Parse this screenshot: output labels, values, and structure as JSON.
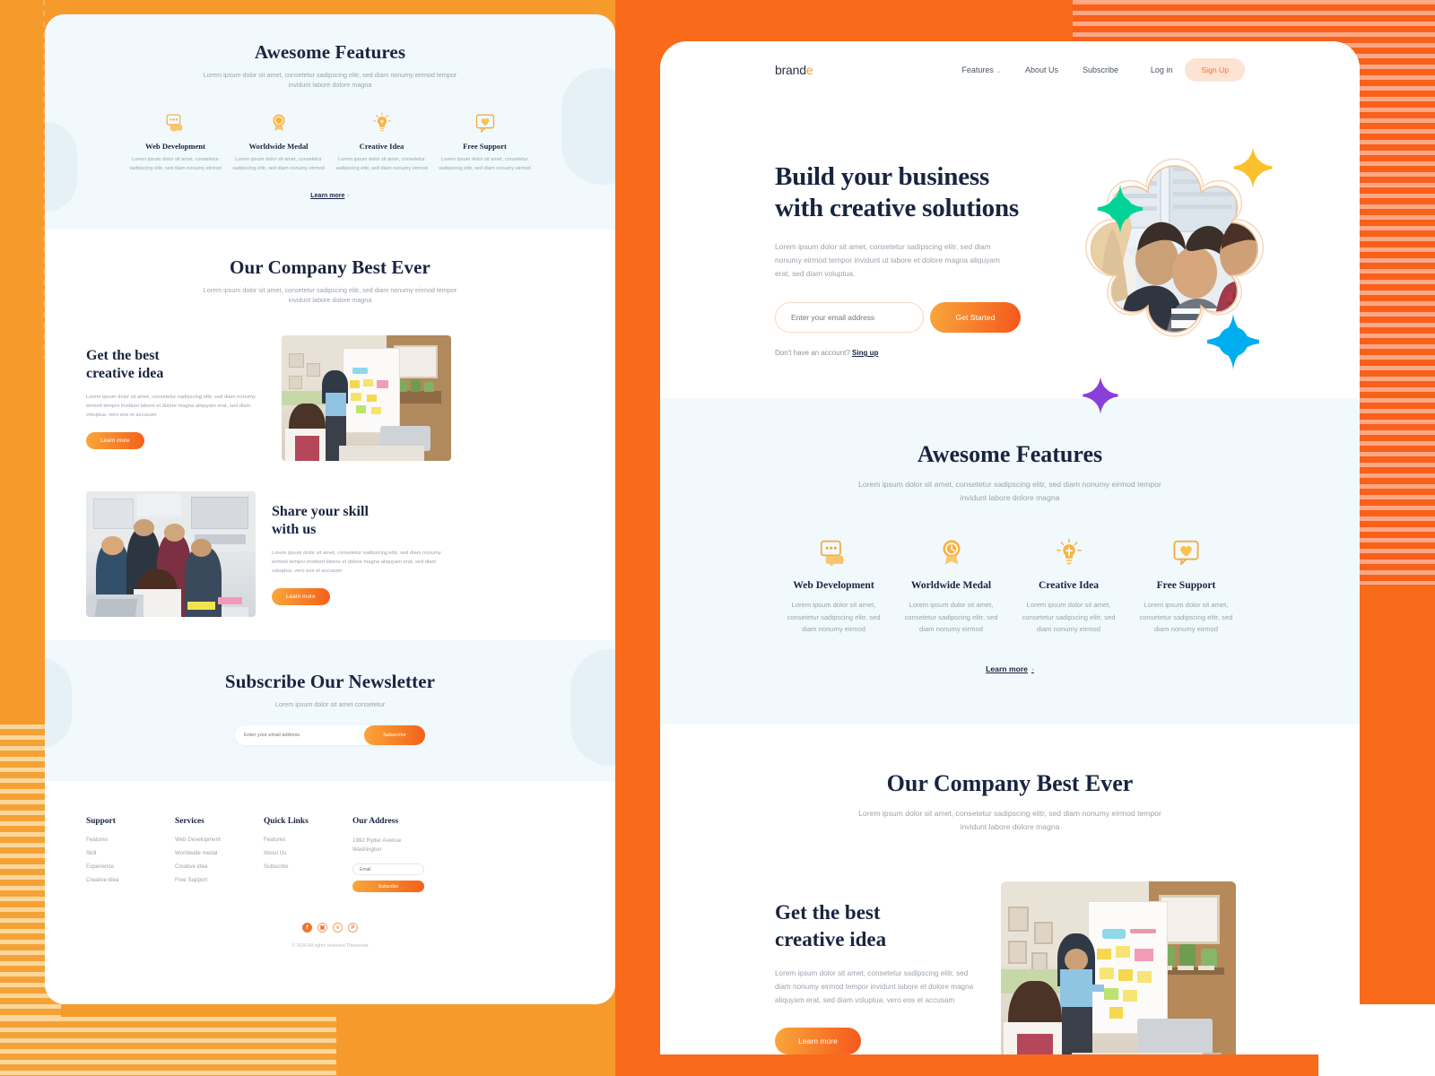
{
  "theme": {
    "orange": "#F96A1B",
    "amber": "#F79A2C",
    "salmon_stripe": "#FCA886",
    "cream_stripe": "#FBD79C",
    "navy_text": "#182440",
    "muted_text": "#9AA3AD",
    "panel_bg_light": "#F1F9FD",
    "accent_gradient_from": "#F9A73A",
    "accent_gradient_to": "#F4571C",
    "signup_bg": "#FDE3D4",
    "signup_text": "#F4723A",
    "star_green": "#00D395",
    "star_amber": "#FBC02D",
    "star_cyan": "#00AEEF",
    "star_purple": "#8B3FD9"
  },
  "navbar": {
    "logo_main": "brand",
    "logo_accent": "e",
    "links": [
      {
        "label": "Features",
        "has_caret": true,
        "caret": "⌄"
      },
      {
        "label": "About Us",
        "has_caret": false
      },
      {
        "label": "Subscribe",
        "has_caret": false
      }
    ],
    "login_label": "Log in",
    "signup_label": "Sign Up"
  },
  "hero": {
    "title_line1": "Build your business",
    "title_line2": "with creative solutions",
    "paragraph": "Lorem ipsum dolor sit amet, consetetur sadipscing elitr, sed diam nonumy eirmod tempor invidunt ut labore et dolore magna aliquyam erat, sed diam voluptua.",
    "email_placeholder": "Enter your email address",
    "email_value": "",
    "cta_label": "Get Started",
    "note_text": "Don't have an account?",
    "note_link": "Sing up"
  },
  "features": {
    "title": "Awesome Features",
    "subtitle": "Lorem ipsum dolor sit amet, consetetur sadipscing elitr, sed diam nonumy eirmod tempor invidunt labore dolore magna",
    "items": [
      {
        "icon": "chat-bubble-icon",
        "title": "Web Development",
        "text": "Lorem ipsum dolor sit amet, consetetur sadipscing elitr, sed diam nonumy eirmod"
      },
      {
        "icon": "medal-icon",
        "title": "Worldwide Medal",
        "text": "Lorem ipsum dolor sit amet, consetetur sadipscing elitr, sed diam nonumy eirmod"
      },
      {
        "icon": "lightbulb-icon",
        "title": "Creative Idea",
        "text": "Lorem ipsum dolor sit amet, consetetur sadipscing elitr, sed diam nonumy eirmod"
      },
      {
        "icon": "heart-chat-icon",
        "title": "Free Support",
        "text": "Lorem ipsum dolor sit amet, consetetur sadipscing elitr, sed diam nonumy eirmod"
      }
    ],
    "learn_more": "Learn more",
    "learn_more_chevron": "›"
  },
  "company": {
    "title": "Our Company Best Ever",
    "subtitle": "Lorem ipsum dolor sit amet, consetetur sadipscing elitr, sed diam nonumy eirmod tempor invidunt labore dolore magna",
    "block1": {
      "title_line1": "Get the best",
      "title_line2": "creative idea",
      "text": "Lorem ipsum dolor sit amet, consetetur sadipscing elitr, sed diam nonumy eirmod tempor invidunt labore et dolore magna aliquyam erat, sed diam voluptua. vero eos et accusam",
      "button": "Learn more",
      "image_alt": "whiteboard-brainstorm-photo"
    },
    "block2": {
      "title_line1": "Share your skill",
      "title_line2": "with us",
      "text": "Lorem ipsum dolor sit amet, consetetur sadipscing elitr, sed diam nonumy eirmod tempor invidunt labore et dolore magna aliquyam erat, sed diam voluptua. vero eos et accusam",
      "button": "Learn more",
      "image_alt": "office-team-laptop-photo"
    }
  },
  "newsletter": {
    "title": "Subscribe Our Newsletter",
    "subtitle": "Lorem ipsum dolor sit amet consetetur",
    "email_placeholder": "Enter your email address",
    "email_value": "",
    "button": "Subscribe"
  },
  "footer": {
    "columns": [
      {
        "heading": "Support",
        "links": [
          "Features",
          "Skill",
          "Experience",
          "Creative idea"
        ]
      },
      {
        "heading": "Services",
        "links": [
          "Web Development",
          "Worldwide medal",
          "Creative idea",
          "Free Support"
        ]
      },
      {
        "heading": "Quick Links",
        "links": [
          "Features",
          "About Us",
          "Subscribe"
        ]
      }
    ],
    "address": {
      "heading": "Our Address",
      "line1": "1992 Ryder Avenue",
      "line2": "Washington",
      "email_placeholder": "Email",
      "email_value": "",
      "button": "Subscribe"
    },
    "social": [
      {
        "name": "facebook-icon",
        "glyph": "f",
        "filled": true
      },
      {
        "name": "instagram-icon",
        "glyph": "▣",
        "filled": false
      },
      {
        "name": "twitter-icon",
        "glyph": "ᴠ",
        "filled": false
      },
      {
        "name": "pinterest-icon",
        "glyph": "P",
        "filled": false
      }
    ],
    "copyright": "© 2020 All rights reserved Themestar"
  }
}
